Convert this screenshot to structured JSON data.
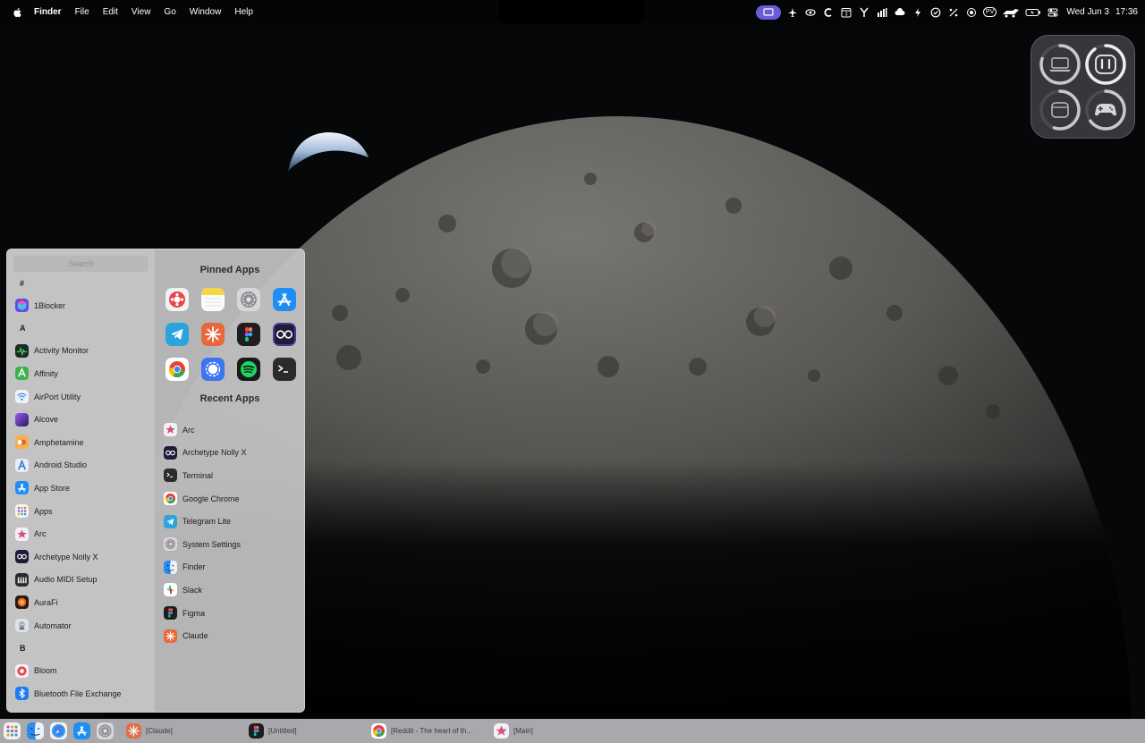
{
  "menubar": {
    "app_name": "Finder",
    "menus": [
      "File",
      "Edit",
      "View",
      "Go",
      "Window",
      "Help"
    ],
    "status_icons": [
      "screen-share-icon",
      "airplane-icon",
      "eye-icon",
      "c-icon",
      "calendar-icon",
      "fork-icon",
      "wifi-signal-icon",
      "cloud-upload-icon",
      "bolt-icon",
      "check-circle-icon",
      "percent-icon",
      "hotspot-icon",
      "pv-badge",
      "rover-icon",
      "battery-icon",
      "control-center-icon"
    ],
    "calendar_day": "3",
    "pv_label": "PV",
    "date": "Wed Jun 3",
    "time": "17:36"
  },
  "battery_widget": {
    "devices": [
      {
        "name": "laptop-icon",
        "level": 0.8
      },
      {
        "name": "airpods-icon",
        "level": 0.9
      },
      {
        "name": "case-icon",
        "level": 0.55
      },
      {
        "name": "gamepad-icon",
        "level": 0.65
      }
    ]
  },
  "launcher": {
    "search_placeholder": "Search",
    "sections": [
      {
        "header": "#",
        "apps": [
          {
            "label": "1Blocker",
            "icon": "1blocker-icon",
            "color": "#5a3be0"
          }
        ]
      },
      {
        "header": "A",
        "apps": [
          {
            "label": "Activity Monitor",
            "icon": "activity-monitor-icon",
            "color": "#1f2a22"
          },
          {
            "label": "Affinity",
            "icon": "affinity-icon",
            "color": "#3fb24a"
          },
          {
            "label": "AirPort Utility",
            "icon": "airport-utility-icon",
            "color": "#eef2f6"
          },
          {
            "label": "Alcove",
            "icon": "alcove-icon",
            "color": "#6d3ad6"
          },
          {
            "label": "Amphetamine",
            "icon": "amphetamine-icon",
            "color": "#f07a2a"
          },
          {
            "label": "Android Studio",
            "icon": "android-studio-icon",
            "color": "#e9eef5"
          },
          {
            "label": "App Store",
            "icon": "app-store-icon",
            "color": "#1e8ef5"
          },
          {
            "label": "Apps",
            "icon": "apps-icon",
            "color": "#f3f3f5"
          },
          {
            "label": "Arc",
            "icon": "arc-icon",
            "color": "#f4f0f6"
          },
          {
            "label": "Archetype Nolly X",
            "icon": "archetype-icon",
            "color": "#1f1c3a"
          },
          {
            "label": "Audio MIDI Setup",
            "icon": "audio-midi-icon",
            "color": "#2a2a2c"
          },
          {
            "label": "AuraFi",
            "icon": "aurafi-icon",
            "color": "#d8691f"
          },
          {
            "label": "Automator",
            "icon": "automator-icon",
            "color": "#cfd4da"
          }
        ]
      },
      {
        "header": "B",
        "apps": [
          {
            "label": "Bloom",
            "icon": "bloom-icon",
            "color": "#f2f2f4"
          },
          {
            "label": "Bluetooth File Exchange",
            "icon": "bluetooth-icon",
            "color": "#1f7cf0"
          }
        ]
      }
    ],
    "pinned_title": "Pinned Apps",
    "pinned": [
      {
        "name": "bloom-icon",
        "color": "#e8464b"
      },
      {
        "name": "notes-icon",
        "color": "#f7d54a"
      },
      {
        "name": "system-settings-icon",
        "color": "#8e8e93"
      },
      {
        "name": "app-store-icon",
        "color": "#1e8ef5"
      },
      {
        "name": "telegram-icon",
        "color": "#2aa3df"
      },
      {
        "name": "claude-icon",
        "color": "#e8673c"
      },
      {
        "name": "figma-icon",
        "color": "#1e1e1e"
      },
      {
        "name": "archetype-icon",
        "color": "#1f1c3a"
      },
      {
        "name": "chrome-icon",
        "color": "#ffffff"
      },
      {
        "name": "signal-icon",
        "color": "#3a76f0"
      },
      {
        "name": "spotify-icon",
        "color": "#1a1a1a"
      },
      {
        "name": "terminal-icon",
        "color": "#2b2b2d"
      }
    ],
    "recent_title": "Recent Apps",
    "recent": [
      {
        "label": "Arc",
        "icon": "arc-icon"
      },
      {
        "label": "Archetype Nolly X",
        "icon": "archetype-icon"
      },
      {
        "label": "Terminal",
        "icon": "terminal-icon"
      },
      {
        "label": "Google Chrome",
        "icon": "chrome-icon"
      },
      {
        "label": "Telegram Lite",
        "icon": "telegram-icon"
      },
      {
        "label": "System Settings",
        "icon": "system-settings-icon"
      },
      {
        "label": "Finder",
        "icon": "finder-icon"
      },
      {
        "label": "Slack",
        "icon": "slack-icon"
      },
      {
        "label": "Figma",
        "icon": "figma-icon"
      },
      {
        "label": "Claude",
        "icon": "claude-icon"
      }
    ]
  },
  "taskbar": {
    "dock_icons": [
      "launchpad-icon",
      "finder-icon",
      "safari-icon",
      "app-store-icon",
      "system-settings-icon"
    ],
    "windows": [
      {
        "label": "[Claude]",
        "icon": "claude-icon"
      },
      {
        "label": "[Untitled]",
        "icon": "figma-icon"
      },
      {
        "label": "[Reddit - The heart of th...",
        "icon": "chrome-icon"
      },
      {
        "label": "[Main]",
        "icon": "arc-icon"
      }
    ]
  }
}
